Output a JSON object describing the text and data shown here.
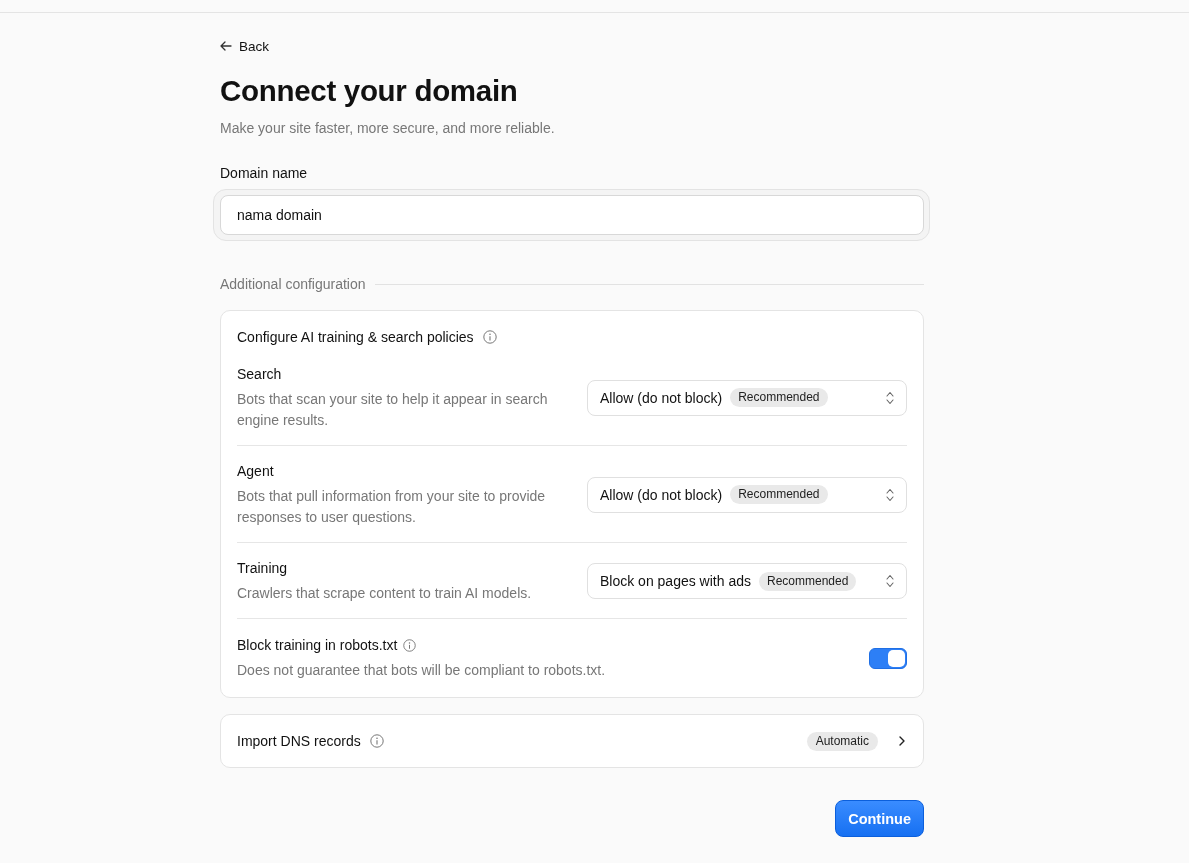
{
  "back": {
    "label": "Back"
  },
  "title": "Connect your domain",
  "subtitle": "Make your site faster, more secure, and more reliable.",
  "domain_field": {
    "label": "Domain name",
    "value": "nama domain"
  },
  "section_heading": "Additional configuration",
  "policies": {
    "title": "Configure AI training & search policies",
    "info": true,
    "rows": [
      {
        "kind": "select",
        "label": "Search",
        "description": "Bots that scan your site to help it appear in search engine results.",
        "value": "Allow (do not block)",
        "badge": "Recommended",
        "info": false
      },
      {
        "kind": "select",
        "label": "Agent",
        "description": "Bots that pull information from your site to provide responses to user questions.",
        "value": "Allow (do not block)",
        "badge": "Recommended",
        "info": false
      },
      {
        "kind": "select",
        "label": "Training",
        "description": "Crawlers that scrape content to train AI models.",
        "value": "Block on pages with ads",
        "badge": "Recommended",
        "info": false
      },
      {
        "kind": "toggle",
        "label": "Block training in robots.txt",
        "description": "Does not guarantee that bots will be compliant to robots.txt.",
        "on": true,
        "info": true
      }
    ]
  },
  "import_dns": {
    "label": "Import DNS records",
    "badge": "Automatic",
    "info": true
  },
  "continue_button": "Continue"
}
